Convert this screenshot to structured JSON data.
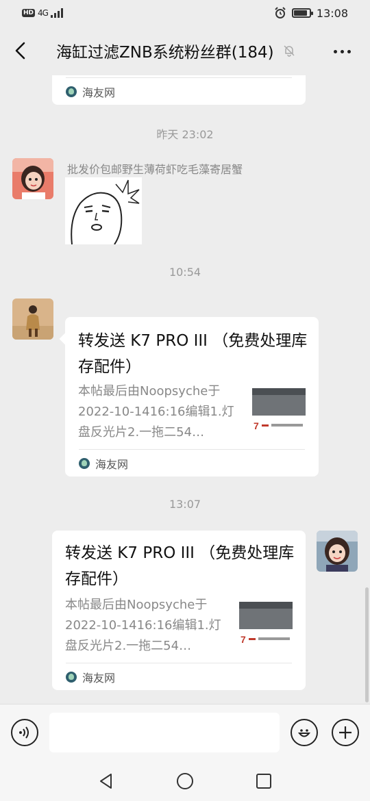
{
  "status_bar": {
    "network": "4G",
    "network_badge": "HD",
    "time": "13:08",
    "battery_level": 0.85
  },
  "header": {
    "title": "海缸过滤ZNB系统粉丝群(184)",
    "back_icon": "chevron-left-icon",
    "mute_icon": "bell-off-icon",
    "more_icon": "more-dots-icon"
  },
  "messages": {
    "card0": {
      "source": "海友网"
    },
    "ts1": "昨天 23:02",
    "msg1": {
      "sender_name": "批发价包邮野生薄荷虾吃毛藻寄居蟹"
    },
    "ts2": "10:54",
    "msg2": {
      "title": "转发送 K7 PRO III （免费处理库存配件）",
      "desc": "本帖最后由Noopsyche于2022-10-1416:16编辑1.灯盘反光片2.一拖二54…",
      "source": "海友网"
    },
    "ts3": "13:07",
    "msg3": {
      "title": "转发送 K7 PRO III （免费处理库存配件）",
      "desc": "本帖最后由Noopsyche于2022-10-1416:16编辑1.灯盘反光片2.一拖二54…",
      "source": "海友网"
    }
  },
  "input_bar": {
    "voice_icon": "voice-icon",
    "emoji_icon": "emoji-icon",
    "plus_icon": "plus-icon",
    "placeholder": ""
  },
  "nav": {
    "back_icon": "nav-back-icon",
    "home_icon": "nav-home-icon",
    "recent_icon": "nav-recent-icon"
  }
}
